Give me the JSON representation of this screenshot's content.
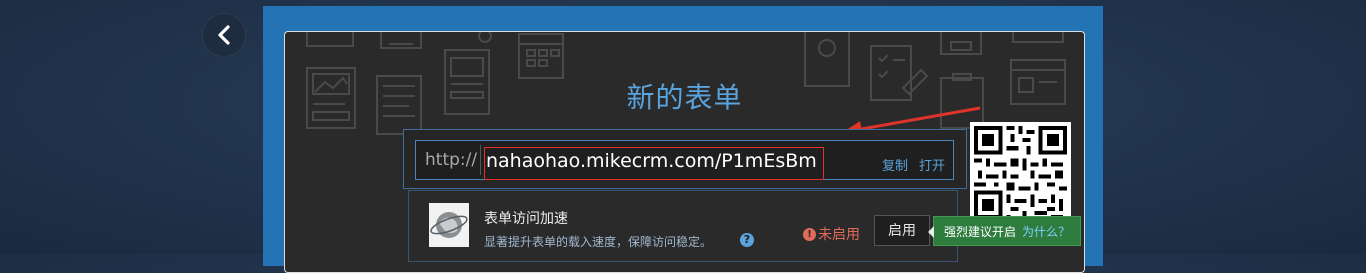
{
  "nav": {
    "back_icon": "chevron-left-icon"
  },
  "form": {
    "title": "新的表单",
    "url_prefix": "http://",
    "url": "nahaohao.mikecrm.com/P1mEsBm",
    "copy_label": "复制",
    "open_label": "打开"
  },
  "accelerate": {
    "title": "表单访问加速",
    "description": "显著提升表单的载入速度，保障访问稳定。",
    "help_glyph": "?",
    "status_text": "未启用",
    "enable_label": "启用",
    "tip_text": "强烈建议开启",
    "tip_link": "为什么？"
  },
  "colors": {
    "frame": "#2473b5",
    "accent": "#5aa3dc",
    "highlight": "#e0332a",
    "tip_bg": "#2e7d3e"
  }
}
